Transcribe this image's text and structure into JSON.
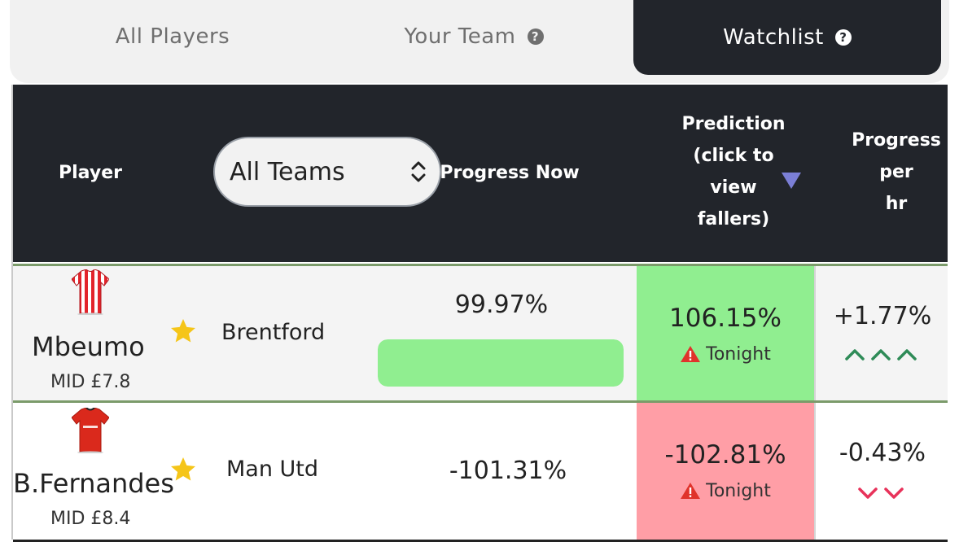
{
  "tabs": [
    {
      "label": "All Players",
      "help": false,
      "active": false
    },
    {
      "label": "Your Team",
      "help": true,
      "active": false
    },
    {
      "label": "Watchlist",
      "help": true,
      "active": true
    }
  ],
  "table": {
    "headers": {
      "player": "Player",
      "team_filter": "All Teams",
      "progress_now": "Progress Now",
      "prediction_lines": [
        "Prediction",
        "(click to",
        "view",
        "fallers)"
      ],
      "progress_per_hr_lines": [
        "Progress",
        "per",
        "hr"
      ]
    },
    "rows": [
      {
        "name": "Mbeumo",
        "meta": "MID £7.8",
        "team": "Brentford",
        "jersey": "brentford-kit",
        "progress_now": "99.97%",
        "progress_fraction": 1.0,
        "prediction": "106.15%",
        "prediction_when": "Tonight",
        "prediction_color": "#90ee90",
        "per_hr": "+1.77%",
        "trend": "up",
        "trend_arrows": 3,
        "trend_color": "#2e8b57"
      },
      {
        "name": "B.Fernandes",
        "meta": "MID £8.4",
        "team": "Man Utd",
        "jersey": "man-utd-kit",
        "progress_now": "-101.31%",
        "progress_fraction": 0,
        "prediction": "-102.81%",
        "prediction_when": "Tonight",
        "prediction_color": "#ff9ea6",
        "per_hr": "-0.43%",
        "trend": "down",
        "trend_arrows": 2,
        "trend_color": "#e8325a"
      }
    ]
  },
  "colors": {
    "header_bg": "#22252b",
    "active_tab_bg": "#22252b",
    "tab_bar_bg": "#f1f1f1",
    "sort_arrow": "#7b7fd6",
    "star": "#f5c518"
  }
}
